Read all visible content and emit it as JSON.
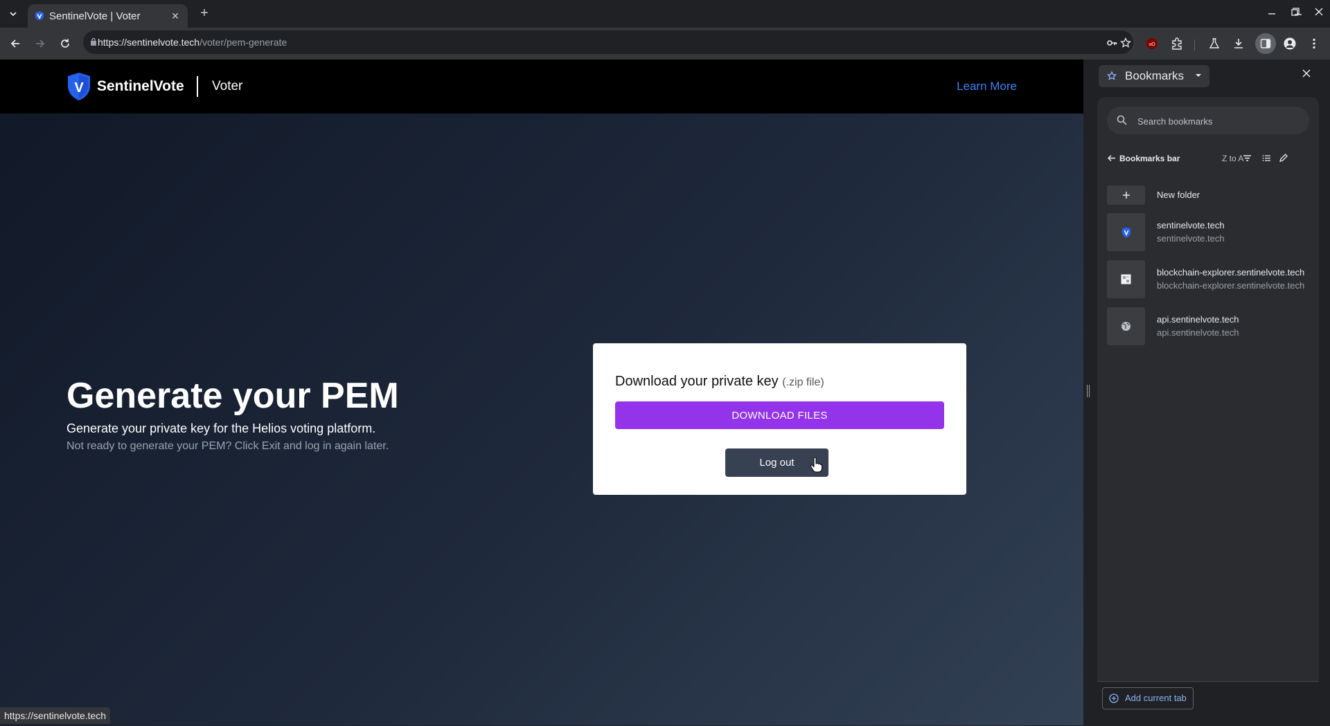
{
  "browser": {
    "tab_title": "SentinelVote | Voter",
    "url_host": "https://sentinelvote.tech",
    "url_path": "/voter/pem-generate",
    "status_url": "https://sentinelvote.tech"
  },
  "site": {
    "brand": "SentinelVote",
    "section": "Voter",
    "learn_more": "Learn More",
    "logo_letter": "V"
  },
  "hero": {
    "title": "Generate your PEM",
    "subtitle": "Generate your private key for the Helios voting platform.",
    "note": "Not ready to generate your PEM? Click Exit and log in again later."
  },
  "card": {
    "heading": "Download your private key",
    "heading_suffix": "(.zip file)",
    "download_label": "DOWNLOAD FILES",
    "logout_label": "Log out"
  },
  "bookmarks": {
    "panel_title": "Bookmarks",
    "search_placeholder": "Search bookmarks",
    "folder": "Bookmarks bar",
    "sort": "Z to A",
    "new_folder": "New folder",
    "items": [
      {
        "title": "sentinelvote.tech",
        "url": "sentinelvote.tech",
        "icon": "shield-icon"
      },
      {
        "title": "blockchain-explorer.sentinelvote.tech",
        "url": "blockchain-explorer.sentinelvote.tech",
        "icon": "page-icon"
      },
      {
        "title": "api.sentinelvote.tech",
        "url": "api.sentinelvote.tech",
        "icon": "globe-icon"
      }
    ],
    "add_current_tab": "Add current tab"
  },
  "colors": {
    "accent_purple": "#9333ea",
    "link_blue": "#3b82f6",
    "brand_shield": "#2563eb",
    "logout_gray": "#374151"
  }
}
